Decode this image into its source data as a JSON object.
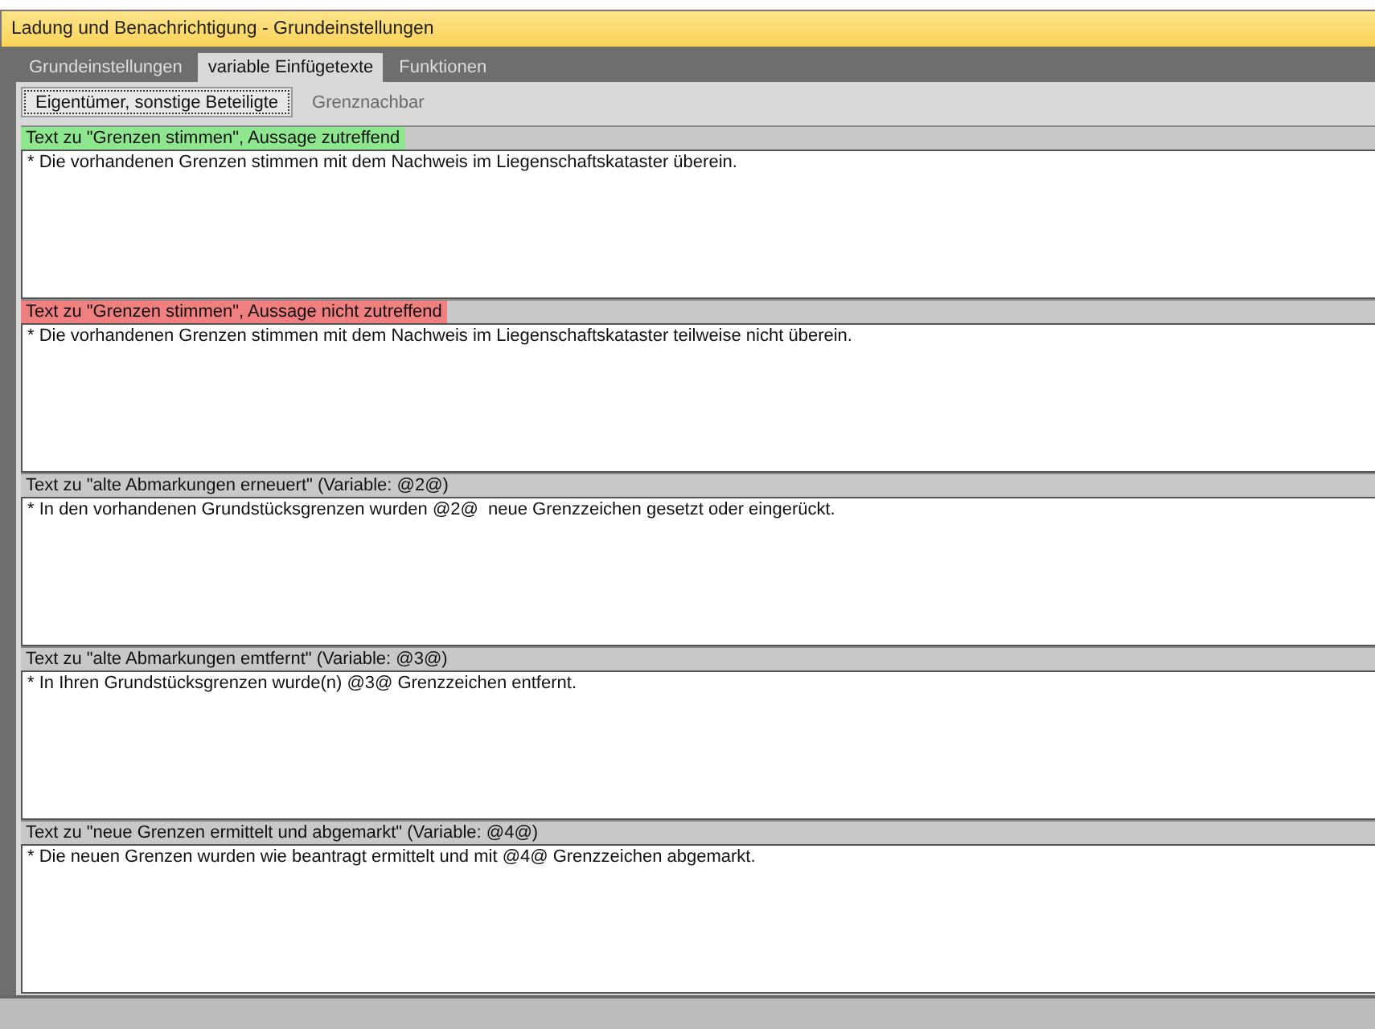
{
  "window": {
    "title": "Ladung und Benachrichtigung - Grundeinstellungen"
  },
  "tabs": [
    {
      "label": "Grundeinstellungen",
      "selected": false
    },
    {
      "label": "variable Einfügetexte",
      "selected": true
    },
    {
      "label": "Funktionen",
      "selected": false
    }
  ],
  "subtabs": [
    {
      "label": "Eigentümer, sonstige Beteiligte",
      "selected": true
    },
    {
      "label": "Grenznachbar",
      "selected": false
    }
  ],
  "sections": [
    {
      "label": "Text zu \"Grenzen stimmen\", Aussage zutreffend",
      "color": "#8ee68e",
      "value": "* Die vorhandenen Grenzen stimmen mit dem Nachweis im Liegenschaftskataster überein."
    },
    {
      "label": "Text zu \"Grenzen stimmen\", Aussage nicht zutreffend",
      "color": "#f08080",
      "value": "* Die vorhandenen Grenzen stimmen mit dem Nachweis im Liegenschaftskataster teilweise nicht überein."
    },
    {
      "label": "Text zu \"alte Abmarkungen erneuert\" (Variable: @2@)",
      "value": "* In den vorhandenen Grundstücksgrenzen wurden @2@  neue Grenzzeichen gesetzt oder eingerückt."
    },
    {
      "label": "Text zu \"alte Abmarkungen emtfernt\" (Variable: @3@)",
      "value": "* In Ihren Grundstücksgrenzen wurde(n) @3@ Grenzzeichen entfernt."
    },
    {
      "label": "Text zu \"neue Grenzen ermittelt und abgemarkt\" (Variable: @4@)",
      "value": "* Die neuen Grenzen wurden wie beantragt ermittelt und mit @4@ Grenzzeichen abgemarkt."
    }
  ]
}
